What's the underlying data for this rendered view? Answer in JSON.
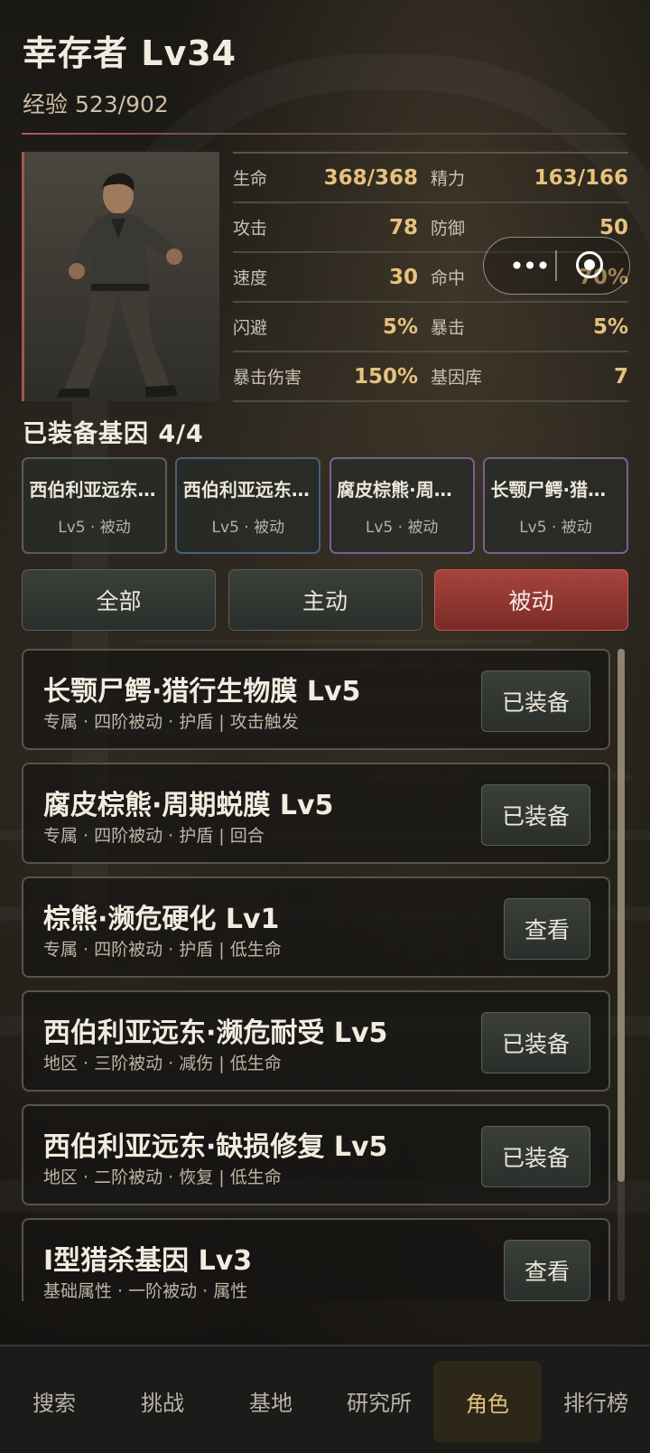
{
  "header": {
    "title": "幸存者 Lv34",
    "exp": "经验 523/902"
  },
  "portrait": {
    "icon": "survivor-portrait"
  },
  "stats": [
    [
      {
        "label": "生命",
        "value": "368/368"
      },
      {
        "label": "精力",
        "value": "163/166"
      }
    ],
    [
      {
        "label": "攻击",
        "value": "78"
      },
      {
        "label": "防御",
        "value": "50"
      }
    ],
    [
      {
        "label": "速度",
        "value": "30"
      },
      {
        "label": "命中",
        "value": "70%"
      }
    ],
    [
      {
        "label": "闪避",
        "value": "5%"
      },
      {
        "label": "暴击",
        "value": "5%"
      }
    ],
    [
      {
        "label": "暴击伤害",
        "value": "150%"
      },
      {
        "label": "基因库",
        "value": "7"
      }
    ]
  ],
  "miniprogram": {
    "more_icon": "more-dots-icon",
    "close_icon": "target-circle-icon",
    "dots": "•••"
  },
  "equipped": {
    "title": "已装备基因 4/4",
    "chips": [
      {
        "name": "西伯利亚远东·缺损修复",
        "sub": "Lv5 · 被动"
      },
      {
        "name": "西伯利亚远东·濒危耐受",
        "sub": "Lv5 · 被动"
      },
      {
        "name": "腐皮棕熊·周期蜕膜",
        "sub": "Lv5 · 被动"
      },
      {
        "name": "长颚尸鳄·猎行生物膜",
        "sub": "Lv5 · 被动"
      }
    ]
  },
  "filters": [
    "全部",
    "主动",
    "被动"
  ],
  "active_filter": "被动",
  "genes": [
    {
      "name": "长颚尸鳄·猎行生物膜 Lv5",
      "desc": "专属 · 四阶被动 · 护盾 | 攻击触发",
      "action": "已装备"
    },
    {
      "name": "腐皮棕熊·周期蜕膜 Lv5",
      "desc": "专属 · 四阶被动 · 护盾 | 回合",
      "action": "已装备"
    },
    {
      "name": "棕熊·濒危硬化 Lv1",
      "desc": "专属 · 四阶被动 · 护盾 | 低生命",
      "action": "查看"
    },
    {
      "name": "西伯利亚远东·濒危耐受 Lv5",
      "desc": "地区 · 三阶被动 · 减伤 | 低生命",
      "action": "已装备"
    },
    {
      "name": "西伯利亚远东·缺损修复 Lv5",
      "desc": "地区 · 二阶被动 · 恢复 | 低生命",
      "action": "已装备"
    },
    {
      "name": "Ⅰ型猎杀基因 Lv3",
      "desc": "基础属性 · 一阶被动 · 属性",
      "action": "查看"
    }
  ],
  "tabs": [
    "搜索",
    "挑战",
    "基地",
    "研究所",
    "角色",
    "排行榜"
  ],
  "active_tab": "角色",
  "colors": {
    "accent_gold": "#e6c27e",
    "active_red": "#a8433d",
    "background": "#14120f"
  }
}
